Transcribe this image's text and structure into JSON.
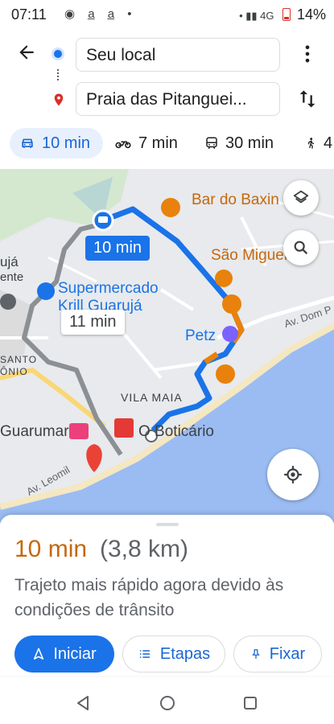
{
  "status_bar": {
    "time": "07:11",
    "notifications": "◉ a̲ a̲ •",
    "right": "• ▮▮ 4G",
    "battery": "14%"
  },
  "route": {
    "origin": "Seu local",
    "destination": "Praia das Pitanguei..."
  },
  "modes": [
    {
      "icon": "car-icon",
      "label": "10 min",
      "active": true
    },
    {
      "icon": "motorcycle-icon",
      "label": "7 min"
    },
    {
      "icon": "transit-icon",
      "label": "30 min"
    },
    {
      "icon": "walk-icon",
      "label": "4"
    }
  ],
  "map": {
    "labels": {
      "bar": "Bar do Baxin",
      "sao_miguel": "São Miguel",
      "supermercado_1": "Supermercado",
      "supermercado_2": "Krill Guarujá",
      "petz": "Petz",
      "av_dom": "Av. Dom P",
      "vila_maia": "VILA MAIA",
      "guarumar": "Guarumar",
      "boticario": "O Boticário",
      "av_leomil": "Av. Leomil",
      "santo": "SANTO",
      "onio": "ÔNIO",
      "uja": "ujá",
      "ente": "ente"
    },
    "primary_time": "10 min",
    "alt_time": "11 min"
  },
  "sheet": {
    "duration": "10 min",
    "distance": "(3,8 km)",
    "description": "Trajeto mais rápido agora devido às condições de trânsito",
    "start_label": "Iniciar",
    "steps_label": "Etapas",
    "pin_label": "Fixar"
  },
  "colors": {
    "accent": "#1a73e8",
    "traffic_orange": "#c5680d",
    "water": "#9bbcf3"
  }
}
